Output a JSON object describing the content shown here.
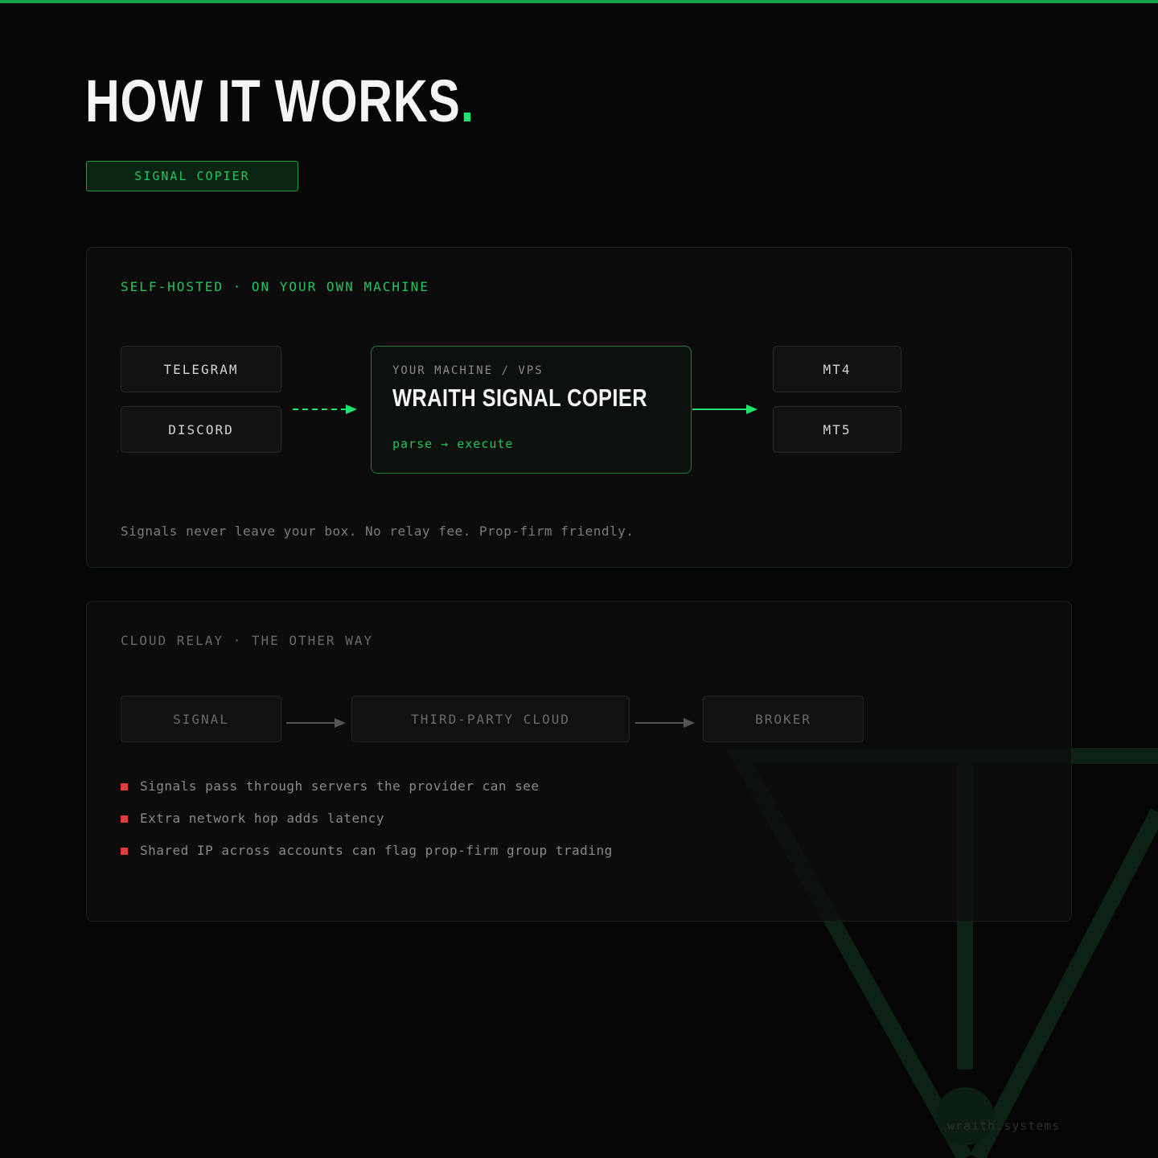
{
  "page": {
    "title": "HOW IT WORKS",
    "title_dot": ".",
    "badge": "SIGNAL COPIER",
    "accent_color": "#22c55e",
    "warning_color": "#e23b3b"
  },
  "self_hosted": {
    "label": "SELF-HOSTED · ON YOUR OWN MACHINE",
    "sources": [
      "TELEGRAM",
      "DISCORD"
    ],
    "core": {
      "subtitle": "YOUR MACHINE / VPS",
      "title": "WRAITH SIGNAL COPIER",
      "flow": "parse → execute"
    },
    "targets": [
      "MT4",
      "MT5"
    ],
    "note": "Signals never leave your box. No relay fee. Prop-firm friendly."
  },
  "cloud_relay": {
    "label": "CLOUD RELAY · THE OTHER WAY",
    "steps": [
      "SIGNAL",
      "THIRD-PARTY CLOUD",
      "BROKER"
    ],
    "cons": [
      "Signals pass through servers the provider can see",
      "Extra network hop adds latency",
      "Shared IP across accounts can flag prop-firm group trading"
    ]
  },
  "footer": "wraith.systems",
  "background_mark": "wraith-triangle-logo"
}
